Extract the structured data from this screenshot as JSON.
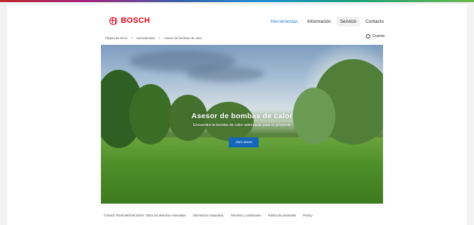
{
  "brand": {
    "name": "BOSCH",
    "color": "#e20015"
  },
  "nav": {
    "items": [
      {
        "label": "Herramientas",
        "active": true
      },
      {
        "label": "Información",
        "active": false
      },
      {
        "label": "Servicio",
        "active": false
      },
      {
        "label": "Contacto",
        "active": false
      }
    ]
  },
  "breadcrumb": {
    "items": [
      "Página de inicio",
      "Herramientas",
      "Asesor de bombas de calor"
    ],
    "separator": ">"
  },
  "account": {
    "label": "Cuenta",
    "icon": "user-icon"
  },
  "hero": {
    "title": "Asesor de bombas de calor",
    "subtitle": "Encuentra la bomba de calor adecuada para tu proyecto",
    "button_label": "Abrir ahora",
    "button_color": "#1466b8"
  },
  "footer": {
    "copyright": "© Bosch Thermotechnik GmbH. Todos los derechos reservados",
    "links": [
      "Información corporativa",
      "Términos y condiciones",
      "Política de privacidad",
      "Privacy"
    ]
  }
}
